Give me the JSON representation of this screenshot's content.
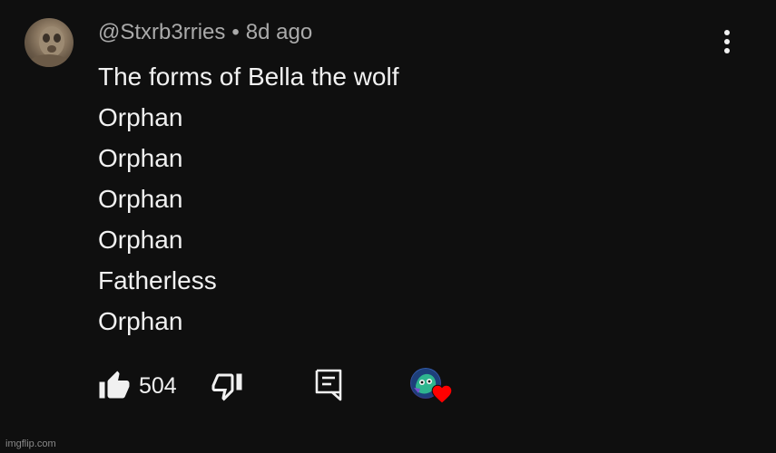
{
  "comment": {
    "author": "@Stxrb3rries",
    "separator": "•",
    "time": "8d ago",
    "lines": [
      "The forms of Bella the wolf",
      "Orphan",
      "Orphan",
      "Orphan",
      "Orphan",
      "Fatherless",
      "Orphan"
    ]
  },
  "actions": {
    "like_count": "504",
    "like_icon": "thumbs-up-icon",
    "dislike_icon": "thumbs-down-icon",
    "reply_icon": "reply-icon",
    "creator_heart_icon": "heart-icon"
  },
  "colors": {
    "background": "#0f0f0f",
    "text": "#f1f1f1",
    "meta": "#aaaaaa",
    "heart": "#ff0000"
  },
  "watermark": "imgflip.com"
}
